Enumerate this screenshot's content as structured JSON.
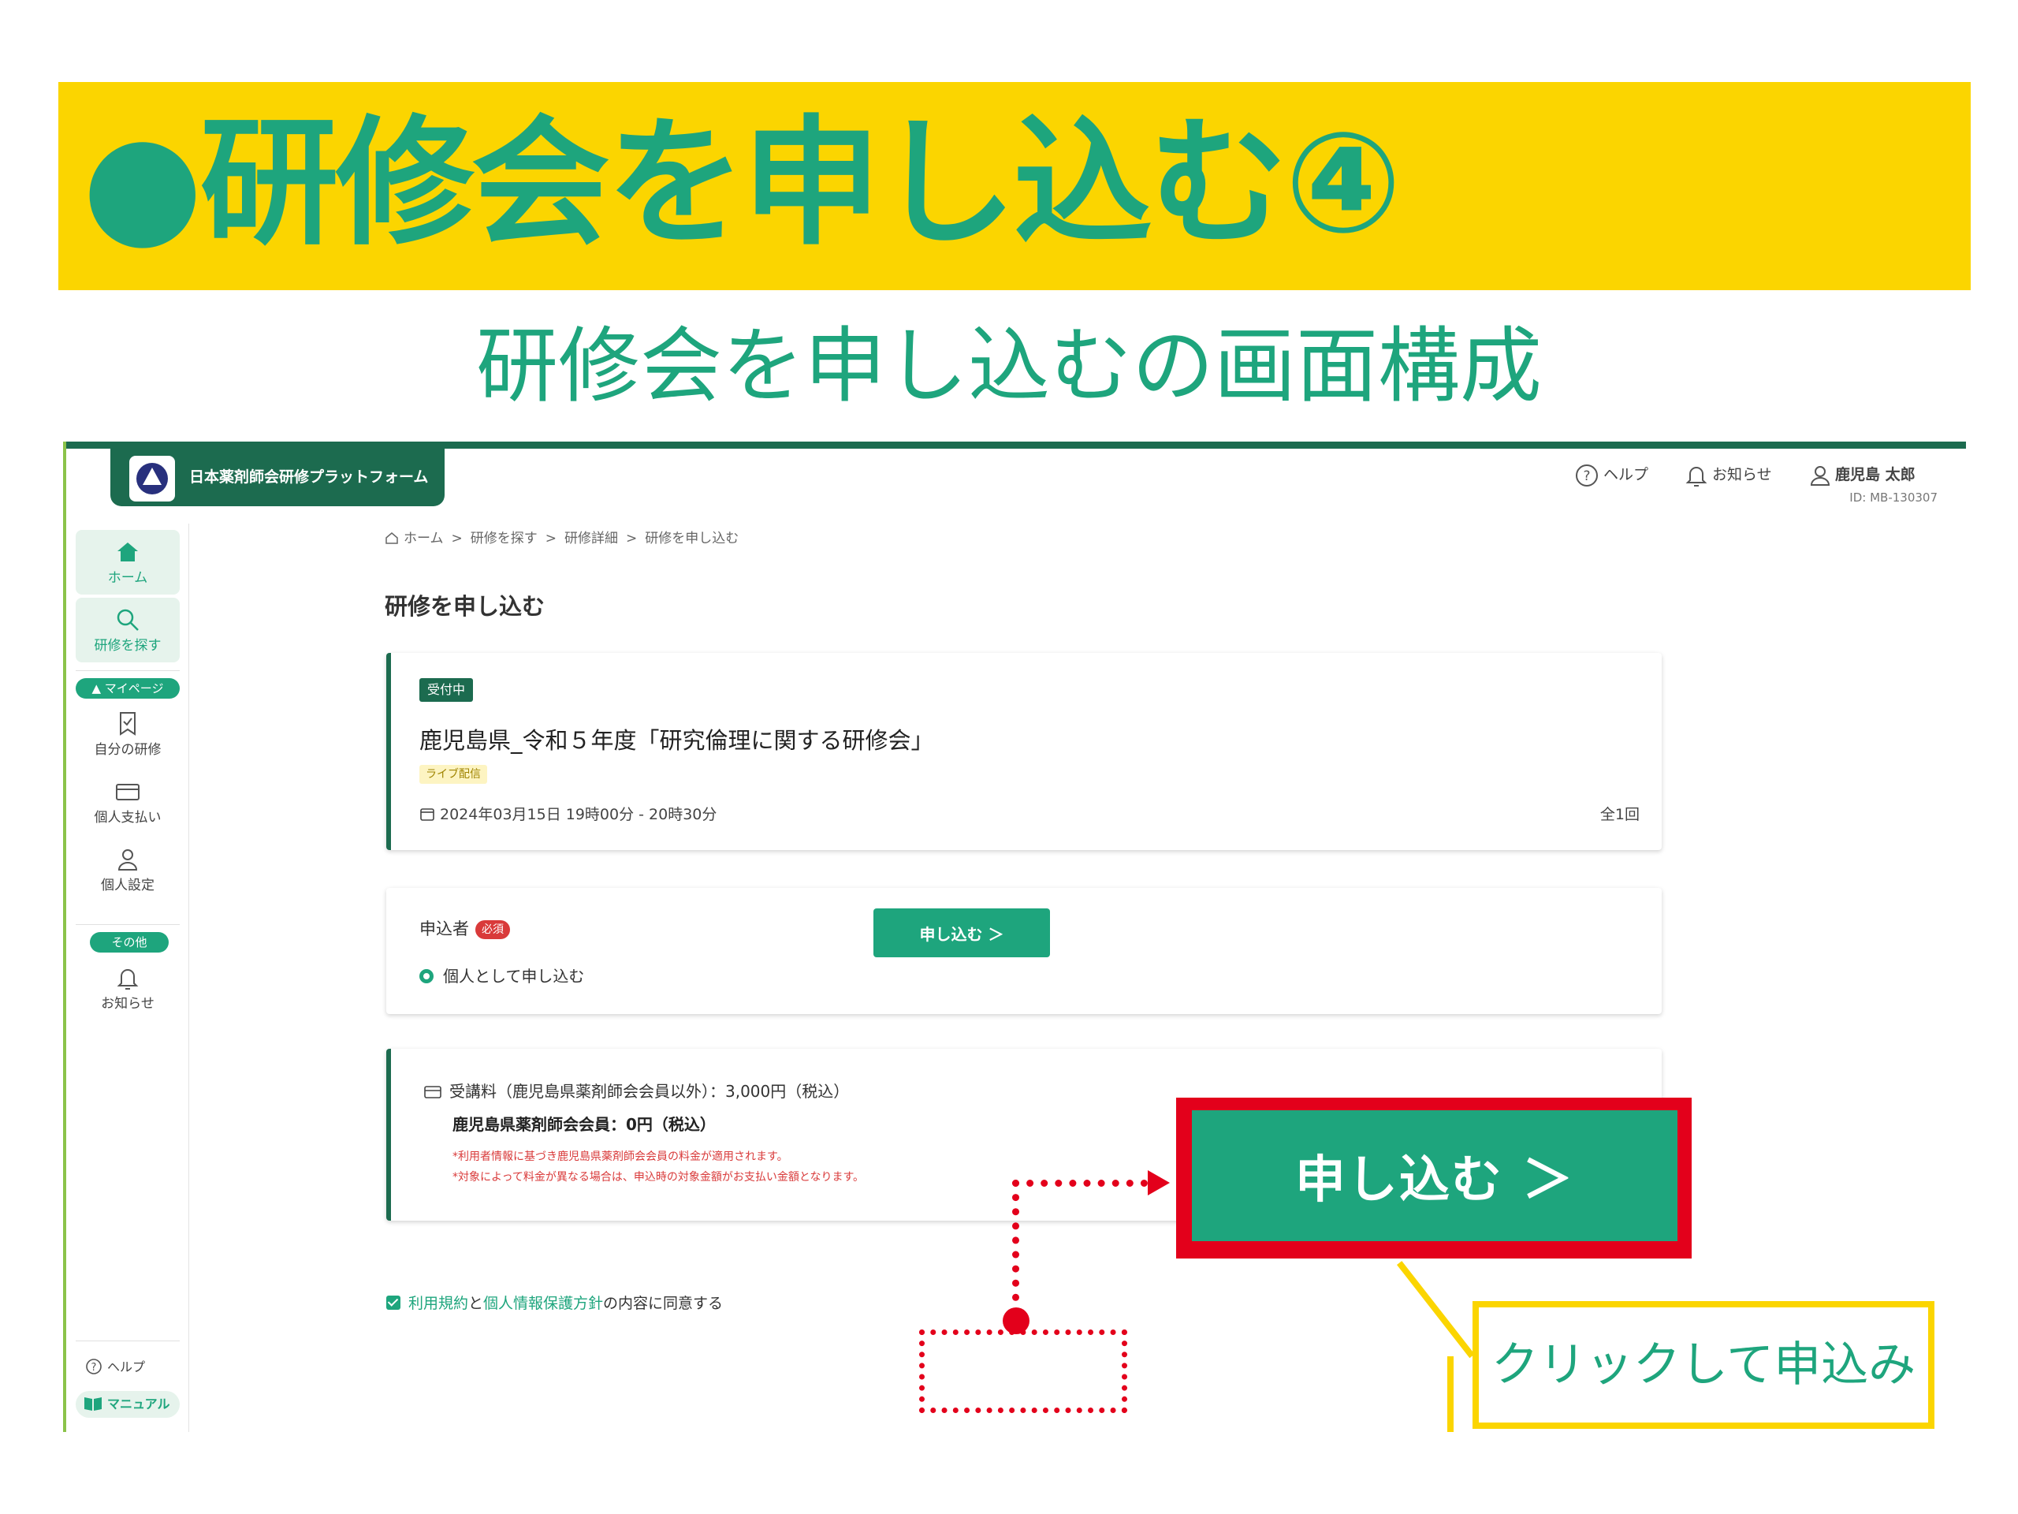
{
  "slide": {
    "title": "●研修会を申し込む④",
    "subtitle": "研修会を申し込むの画面構成"
  },
  "app": {
    "brand_name": "日本薬剤師会研修プラットフォーム",
    "header": {
      "help": "ヘルプ",
      "notices": "お知らせ",
      "user_name": "鹿児島 太郎",
      "user_id": "ID: MB-130307"
    },
    "sidebar": {
      "home": "ホーム",
      "search": "研修を探す",
      "mypage_pill": "▲ マイページ",
      "my_courses": "自分の研修",
      "payment": "個人支払い",
      "settings": "個人設定",
      "other_pill": "その他",
      "notices": "お知らせ",
      "help": "ヘルプ",
      "manual": "マニュアル"
    },
    "breadcrumb": [
      "ホーム",
      ">",
      "研修を探す",
      ">",
      "研修詳細",
      ">",
      "研修を申し込む"
    ],
    "page_title": "研修を申し込む",
    "course": {
      "status": "受付中",
      "title": "鹿児島県_令和５年度「研究倫理に関する研修会」",
      "delivery": "ライブ配信",
      "datetime": "2024年03月15日 19時00分 - 20時30分",
      "sessions": "全1回"
    },
    "applicant": {
      "label": "申込者",
      "required": "必須",
      "option": "個人として申し込む"
    },
    "fee": {
      "line1": "受講料（鹿児島県薬剤師会会員以外）：3,000円（税込）",
      "line2": "鹿児島県薬剤師会会員：0円（税込）",
      "note1": "*利用者情報に基づき鹿児島県薬剤師会会員の料金が適用されます。",
      "note2": "*対象によって料金が異なる場合は、申込時の対象金額がお支払い金額となります。"
    },
    "agreement": {
      "terms": "利用規約",
      "and": "と",
      "privacy": "個人情報保護方針",
      "suffix": "の内容に同意する"
    },
    "apply_button": "申し込む ＞"
  },
  "annotation": {
    "zoom_button": "申し込む ＞",
    "callout": "クリックして申込み"
  },
  "colors": {
    "band": "#fbd500",
    "accent_green": "#1ea57d",
    "dark_green": "#1c6b4f",
    "highlight_red": "#e3001b"
  }
}
